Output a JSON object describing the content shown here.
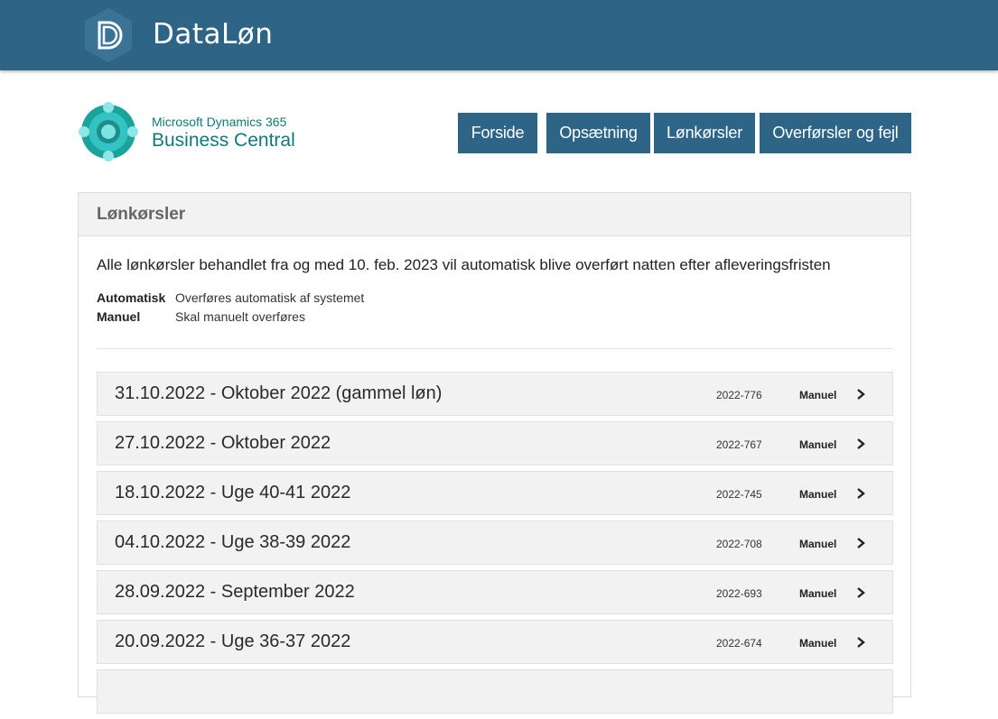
{
  "header": {
    "brand": "DataLøn"
  },
  "bc_logo": {
    "line1": "Microsoft Dynamics 365",
    "line2": "Business Central"
  },
  "nav": {
    "items": [
      {
        "label": "Forside"
      },
      {
        "label": "Opsætning"
      },
      {
        "label": "Lønkørsler"
      },
      {
        "label": "Overførsler og fejl"
      }
    ]
  },
  "panel": {
    "title": "Lønkørsler",
    "info": "Alle lønkørsler behandlet fra og med 10. feb. 2023 vil automatisk blive overført natten efter afleveringsfristen",
    "legend": [
      {
        "key": "Automatisk",
        "value": "Overføres automatisk af systemet"
      },
      {
        "key": "Manuel",
        "value": "Skal manuelt overføres"
      }
    ]
  },
  "runs": [
    {
      "title": "31.10.2022 - Oktober 2022 (gammel løn)",
      "code": "2022-776",
      "mode": "Manuel"
    },
    {
      "title": "27.10.2022 - Oktober 2022",
      "code": "2022-767",
      "mode": "Manuel"
    },
    {
      "title": "18.10.2022 - Uge 40-41 2022",
      "code": "2022-745",
      "mode": "Manuel"
    },
    {
      "title": "04.10.2022 - Uge 38-39 2022",
      "code": "2022-708",
      "mode": "Manuel"
    },
    {
      "title": "28.09.2022 - September 2022",
      "code": "2022-693",
      "mode": "Manuel"
    },
    {
      "title": "20.09.2022 - Uge 36-37 2022",
      "code": "2022-674",
      "mode": "Manuel"
    },
    {
      "title": "",
      "code": "",
      "mode": ""
    }
  ],
  "icons": {
    "chevron": "chevron-right-icon",
    "logo": "dataloen-logo-icon",
    "bc": "business-central-logo-icon"
  },
  "colors": {
    "primary": "#2e6587",
    "bc_teal": "#0f7a78",
    "row_bg": "#f2f2f2"
  }
}
